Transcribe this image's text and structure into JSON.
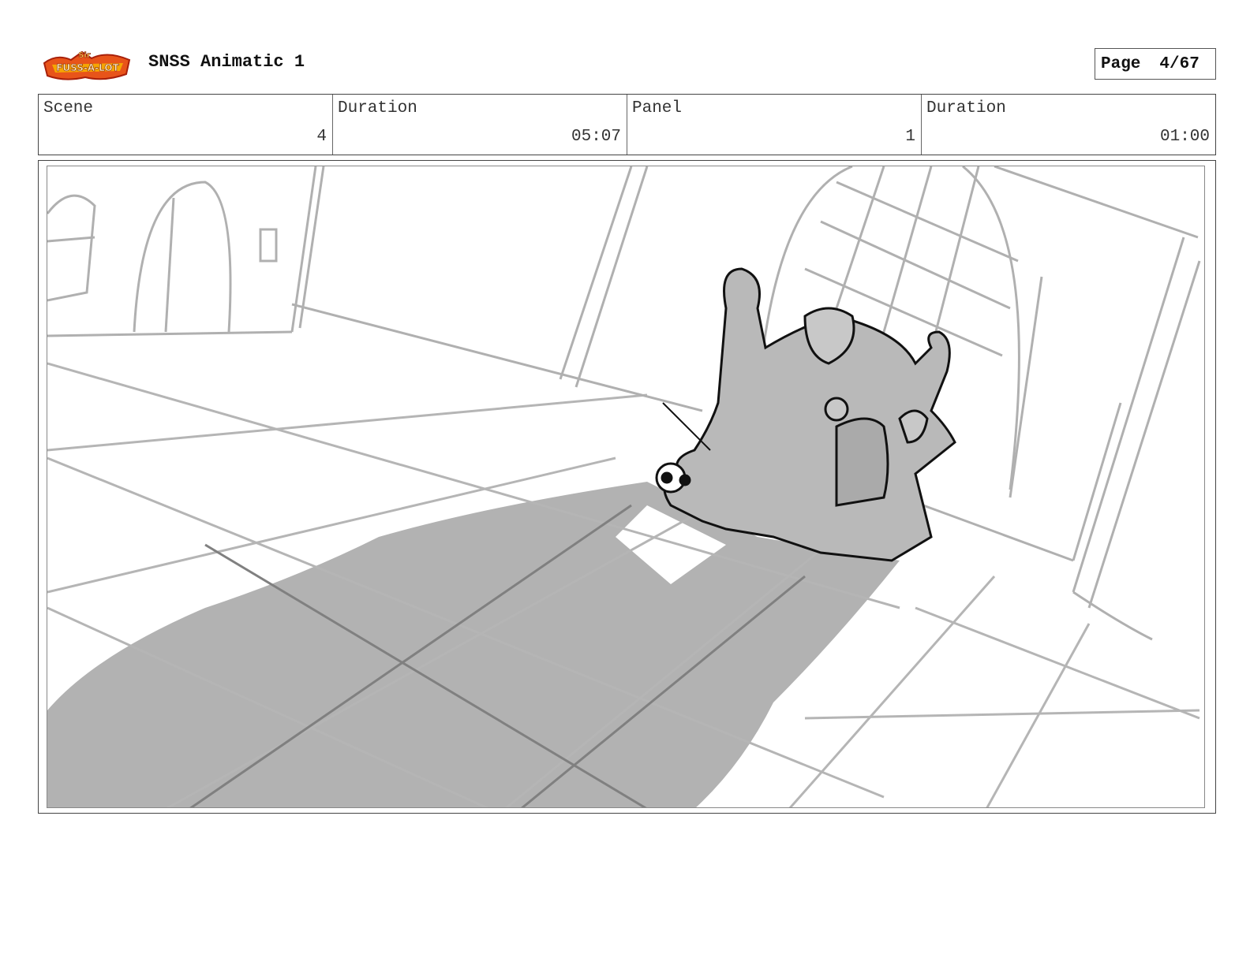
{
  "header": {
    "logo_text": "Sir Fuss-a-Lot",
    "title": "SNSS Animatic 1",
    "page_label": "Page",
    "page_value": "4/67"
  },
  "info": {
    "scene_label": "Scene",
    "scene_value": "4",
    "scene_duration_label": "Duration",
    "scene_duration_value": "05:07",
    "panel_label": "Panel",
    "panel_value": "1",
    "panel_duration_label": "Duration",
    "panel_duration_value": "01:00"
  },
  "panel": {
    "image_name": "storyboard-sketch"
  }
}
